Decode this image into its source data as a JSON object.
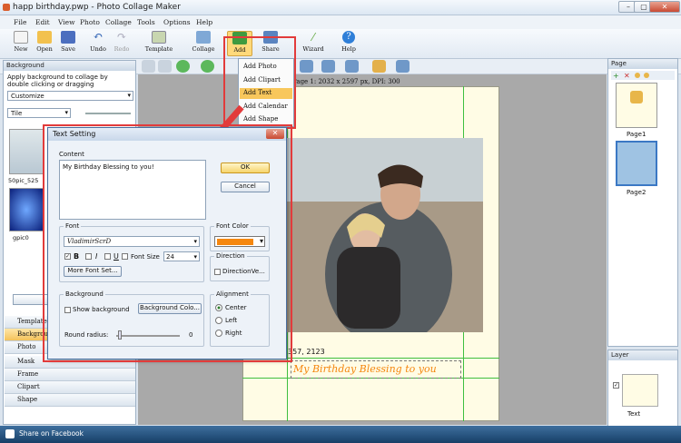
{
  "window": {
    "title": "happ birthday.pwp - Photo Collage Maker"
  },
  "menu": [
    "File",
    "Edit",
    "View",
    "Photo",
    "Collage",
    "Tools",
    "Options",
    "Help"
  ],
  "toolbar": {
    "new": "New",
    "open": "Open",
    "save": "Save",
    "undo": "Undo",
    "redo": "Redo",
    "template": "Template",
    "collage": "Collage",
    "add": "Add",
    "share": "Share",
    "wizard": "Wizard",
    "help": "Help"
  },
  "add_menu": [
    "Add Photo",
    "Add Clipart",
    "Add Text",
    "Add Calendar",
    "Add Shape"
  ],
  "canvas_info": "Page 1: 2032 x 2597 px, DPI: 300",
  "coords_text": "357, 2123",
  "canvas_text": "My Birthday Blessing to you",
  "left_panel": {
    "header": "Background",
    "hint": "Apply background to collage by double clicking or dragging",
    "select_value": "Customize",
    "tile_value": "Tile",
    "thumb1_label": "50pic_525",
    "thumb2_label": "gpic0",
    "tabs": [
      "Template",
      "Background",
      "Photo",
      "Mask",
      "Frame",
      "Clipart",
      "Shape"
    ]
  },
  "dialog": {
    "title": "Text Setting",
    "content_label": "Content",
    "content_text": "My Birthday Blessing to you!",
    "ok": "OK",
    "cancel": "Cancel",
    "font_label": "Font",
    "font_name": "VladimirScrD",
    "bold": "B",
    "italic": "I",
    "underline": "U",
    "font_size_label": "Font Size",
    "font_size": "24",
    "more_font": "More Font Set...",
    "font_color_label": "Font Color",
    "font_color_value": "#f5870f",
    "direction_label": "Direction",
    "direction_value": "DirectionVe...",
    "background_label": "Background",
    "show_bg": "Show background",
    "bg_color_btn": "Background Colo...",
    "round_radius": "Round radius:",
    "round_value": "0",
    "alignment_label": "Alignment",
    "align_options": [
      "Center",
      "Left",
      "Right"
    ],
    "align_selected": "Center"
  },
  "page_panel": {
    "header": "Page",
    "items": [
      "Page1",
      "Page2"
    ]
  },
  "layer_panel": {
    "header": "Layer",
    "item": "Text"
  },
  "status": {
    "share": "Share on Facebook"
  },
  "colors": {
    "accent_red": "#e23b3b",
    "text_orange": "#f5870f",
    "guide_green": "#3fbf3f"
  }
}
